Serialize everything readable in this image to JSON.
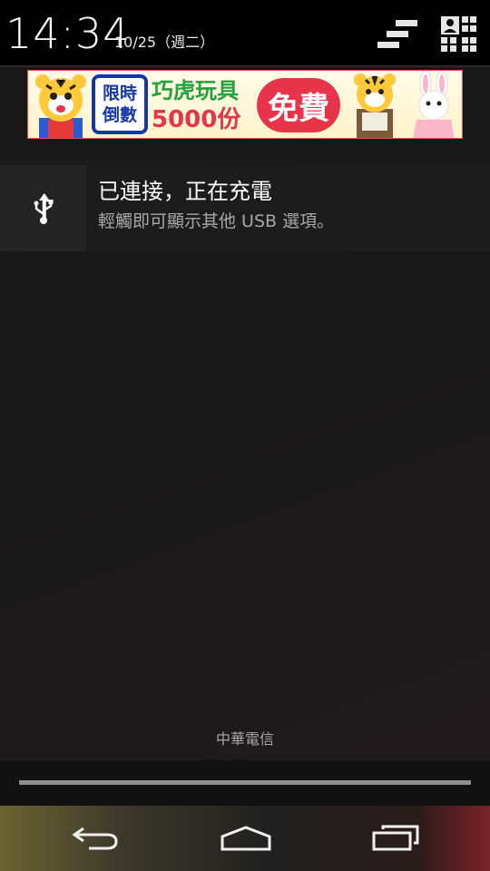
{
  "status": {
    "time": "14:34",
    "date": "10/25（週二）"
  },
  "header": {
    "clear_all_icon": "clear-notifications-icon",
    "quick_settings_icon": "quick-settings-icon"
  },
  "ad": {
    "badge_line1": "限時",
    "badge_line2": "倒數",
    "title": "巧虎玩具",
    "count": "5000份",
    "free_label": "免費",
    "colors": {
      "green": "#21a23c",
      "red": "#e8344a",
      "blue": "#1438a8"
    }
  },
  "notification": {
    "icon": "usb-icon",
    "title": "已連接，正在充電",
    "text": "輕觸即可顯示其他 USB 選項。"
  },
  "carrier": "中華電信",
  "navbar": {
    "back_icon": "back-icon",
    "home_icon": "home-icon",
    "recents_icon": "recent-apps-icon"
  }
}
